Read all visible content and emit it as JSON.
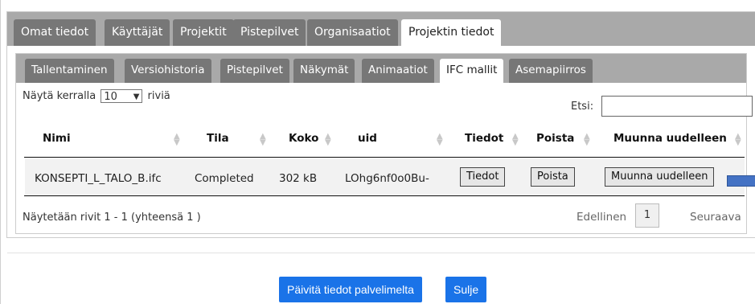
{
  "outer_tabs": [
    {
      "label": "Omat tiedot",
      "active": false
    },
    {
      "label": "Käyttäjät",
      "active": false
    },
    {
      "label": "Projektit",
      "active": false
    },
    {
      "label": "Pistepilvet",
      "active": false
    },
    {
      "label": "Organisaatiot",
      "active": false
    },
    {
      "label": "Projektin tiedot",
      "active": true
    }
  ],
  "inner_tabs": [
    {
      "label": "Tallentaminen",
      "active": false
    },
    {
      "label": "Versiohistoria",
      "active": false
    },
    {
      "label": "Pistepilvet",
      "active": false
    },
    {
      "label": "Näkymät",
      "active": false
    },
    {
      "label": "Animaatiot",
      "active": false
    },
    {
      "label": "IFC mallit",
      "active": true
    },
    {
      "label": "Asemapiirros",
      "active": false
    }
  ],
  "table_controls": {
    "length_prefix": "Näytä kerralla",
    "length_value": "10",
    "length_suffix": "riviä",
    "search_label": "Etsi:",
    "search_value": ""
  },
  "table": {
    "headers": [
      "Nimi",
      "Tila",
      "Koko",
      "uid",
      "Tiedot",
      "Poista",
      "Muunna uudelleen"
    ],
    "rows": [
      {
        "name": "KONSEPTI_L_TALO_B.ifc",
        "status": "Completed",
        "size": "302 kB",
        "uid": "LOhg6nf0o0Bu-",
        "info_button": "Tiedot",
        "delete_button": "Poista",
        "reconvert_button": "Muunna uudelleen"
      }
    ]
  },
  "footer": {
    "info": "Näytetään rivit 1 - 1 (yhteensä 1 )",
    "prev": "Edellinen",
    "page": "1",
    "next": "Seuraava"
  },
  "actions": {
    "refresh": "Päivitä tiedot palvelimelta",
    "close": "Sulje"
  },
  "colors": {
    "tab_inactive": "#777777",
    "tab_bar": "#a9a9a9",
    "primary_button": "#1a73e8",
    "chip": "#4472c4"
  }
}
